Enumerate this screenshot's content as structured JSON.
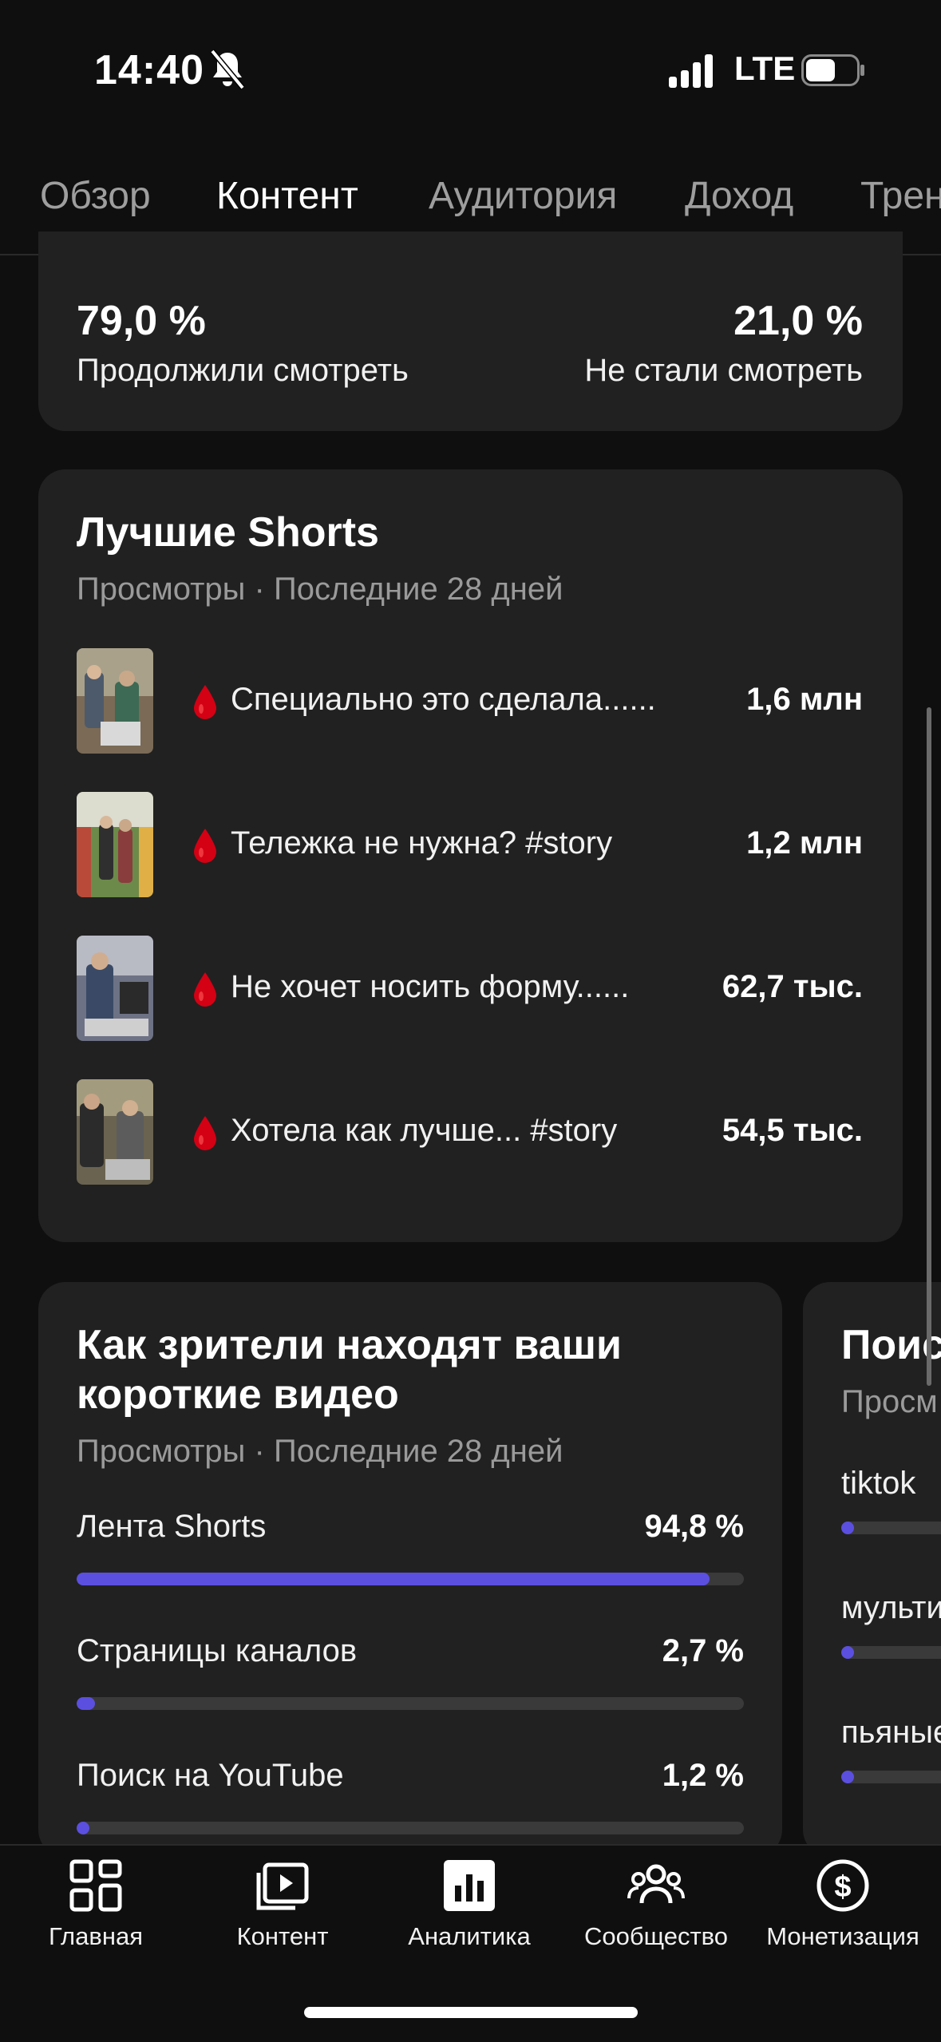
{
  "status_bar": {
    "time": "14:40",
    "network": "LTE"
  },
  "tabs": [
    {
      "label": "Обзор"
    },
    {
      "label": "Контент"
    },
    {
      "label": "Аудитория"
    },
    {
      "label": "Доход"
    },
    {
      "label": "Трен"
    }
  ],
  "retention": {
    "continued_value": "79,0 %",
    "continued_label": "Продолжили смотреть",
    "stopped_value": "21,0 %",
    "stopped_label": "Не стали смотреть"
  },
  "top_shorts": {
    "title": "Лучшие Shorts",
    "subtitle": "Просмотры · Последние 28 дней",
    "rows": [
      {
        "title": "Специально это сделала......",
        "views": "1,6 млн"
      },
      {
        "title": "Тележка не нужна? #story",
        "views": "1,2 млн"
      },
      {
        "title": "Не хочет носить форму......",
        "views": "62,7 тыс."
      },
      {
        "title": "Хотела как лучше... #story",
        "views": "54,5 тыс."
      }
    ]
  },
  "traffic_sources": {
    "title_line1": "Как зрители находят ваши",
    "title_line2": "короткие видео",
    "subtitle": "Просмотры · Последние 28 дней",
    "rows": [
      {
        "label": "Лента Shorts",
        "value": "94,8 %",
        "percent": 94.8
      },
      {
        "label": "Страницы каналов",
        "value": "2,7 %",
        "percent": 2.7
      },
      {
        "label": "Поиск на YouTube",
        "value": "1,2 %",
        "percent": 1.2
      }
    ]
  },
  "search_terms_peek": {
    "title": "Поис",
    "subtitle": "Просм",
    "rows": [
      {
        "label": "tiktok"
      },
      {
        "label": "мульти"
      },
      {
        "label": "пьяные"
      }
    ]
  },
  "bottom_nav": [
    {
      "label": "Главная",
      "icon": "home-grid-icon"
    },
    {
      "label": "Контент",
      "icon": "content-play-icon"
    },
    {
      "label": "Аналитика",
      "icon": "analytics-icon"
    },
    {
      "label": "Сообщество",
      "icon": "community-icon"
    },
    {
      "label": "Монетизация",
      "icon": "monetization-dollar-icon"
    }
  ],
  "colors": {
    "accent_bar": "#5b4fe0",
    "card": "#212121",
    "background": "#0f0f0f",
    "drop": "#d40014"
  }
}
